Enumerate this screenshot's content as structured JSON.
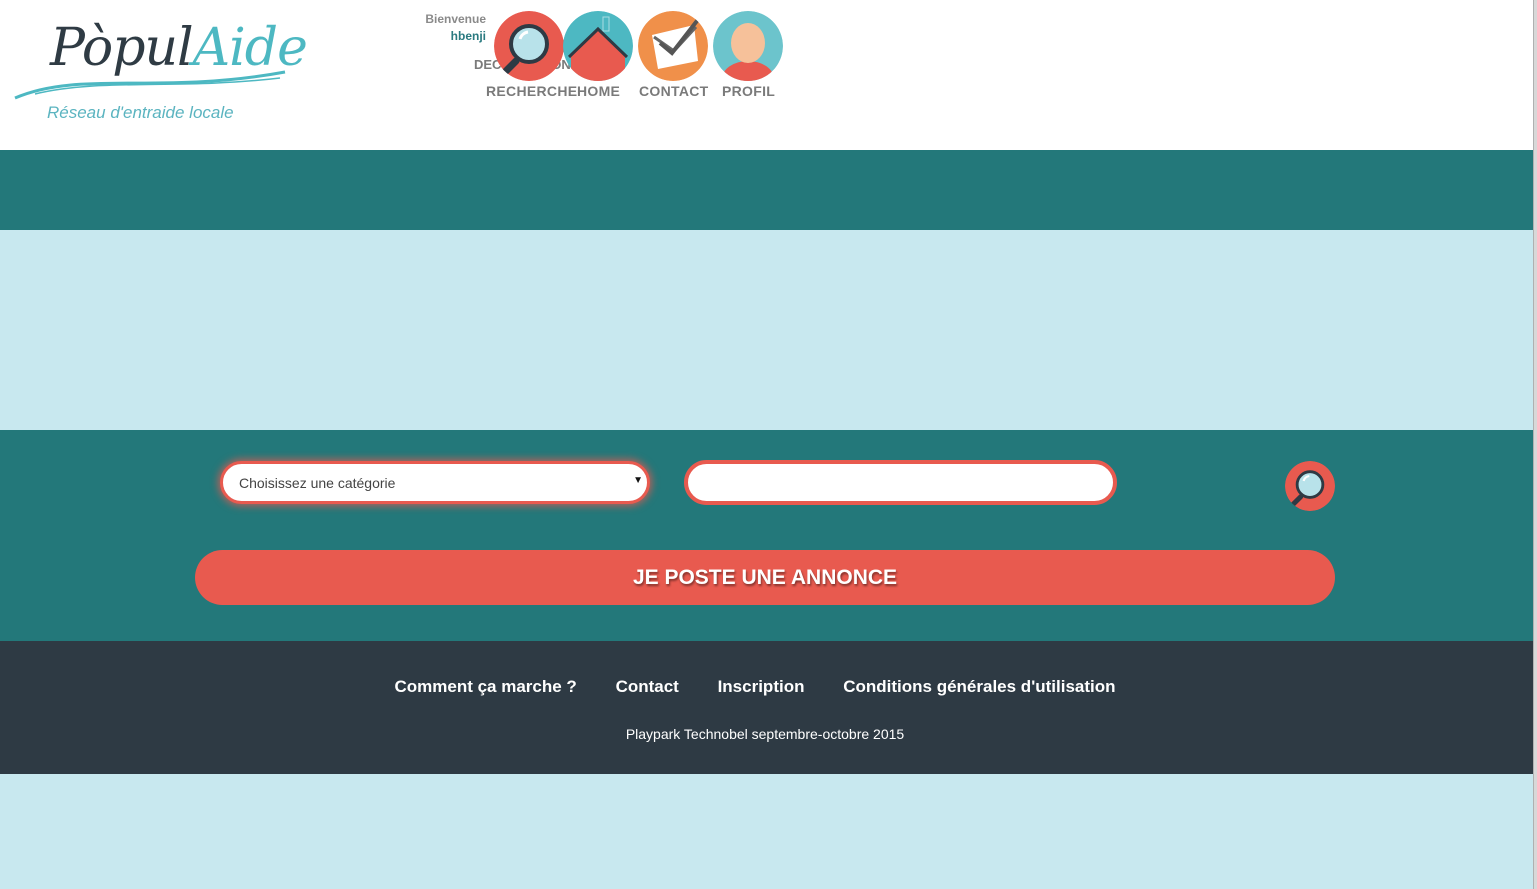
{
  "header": {
    "logo": {
      "name_part1": "Pòpul",
      "name_part2": "Aide",
      "tagline": "Réseau d'entraide locale"
    },
    "welcome_label": "Bienvenue",
    "username": "hbenji",
    "logout_label": "DECONNEXION"
  },
  "nav": [
    {
      "label": "RECHERCHE",
      "icon": "search-icon"
    },
    {
      "label": "HOME",
      "icon": "home-icon"
    },
    {
      "label": "CONTACT",
      "icon": "mail-icon"
    },
    {
      "label": "PROFIL",
      "icon": "user-icon"
    }
  ],
  "search": {
    "category_selected": "Choisissez une catégorie",
    "keyword_value": "",
    "icon": "search-icon"
  },
  "post_button_label": "JE POSTE UNE ANNONCE",
  "footer": {
    "links": [
      "Comment ça marche ?",
      "Contact",
      "Inscription",
      "Conditions générales d'utilisation"
    ],
    "copyright": "Playpark Technobel septembre-octobre 2015"
  },
  "colors": {
    "teal": "#23787a",
    "light_blue": "#c8e8ef",
    "coral": "#e85a4f",
    "dark": "#2e3a44",
    "orange": "#f0904a",
    "cyan": "#4db8c2"
  }
}
